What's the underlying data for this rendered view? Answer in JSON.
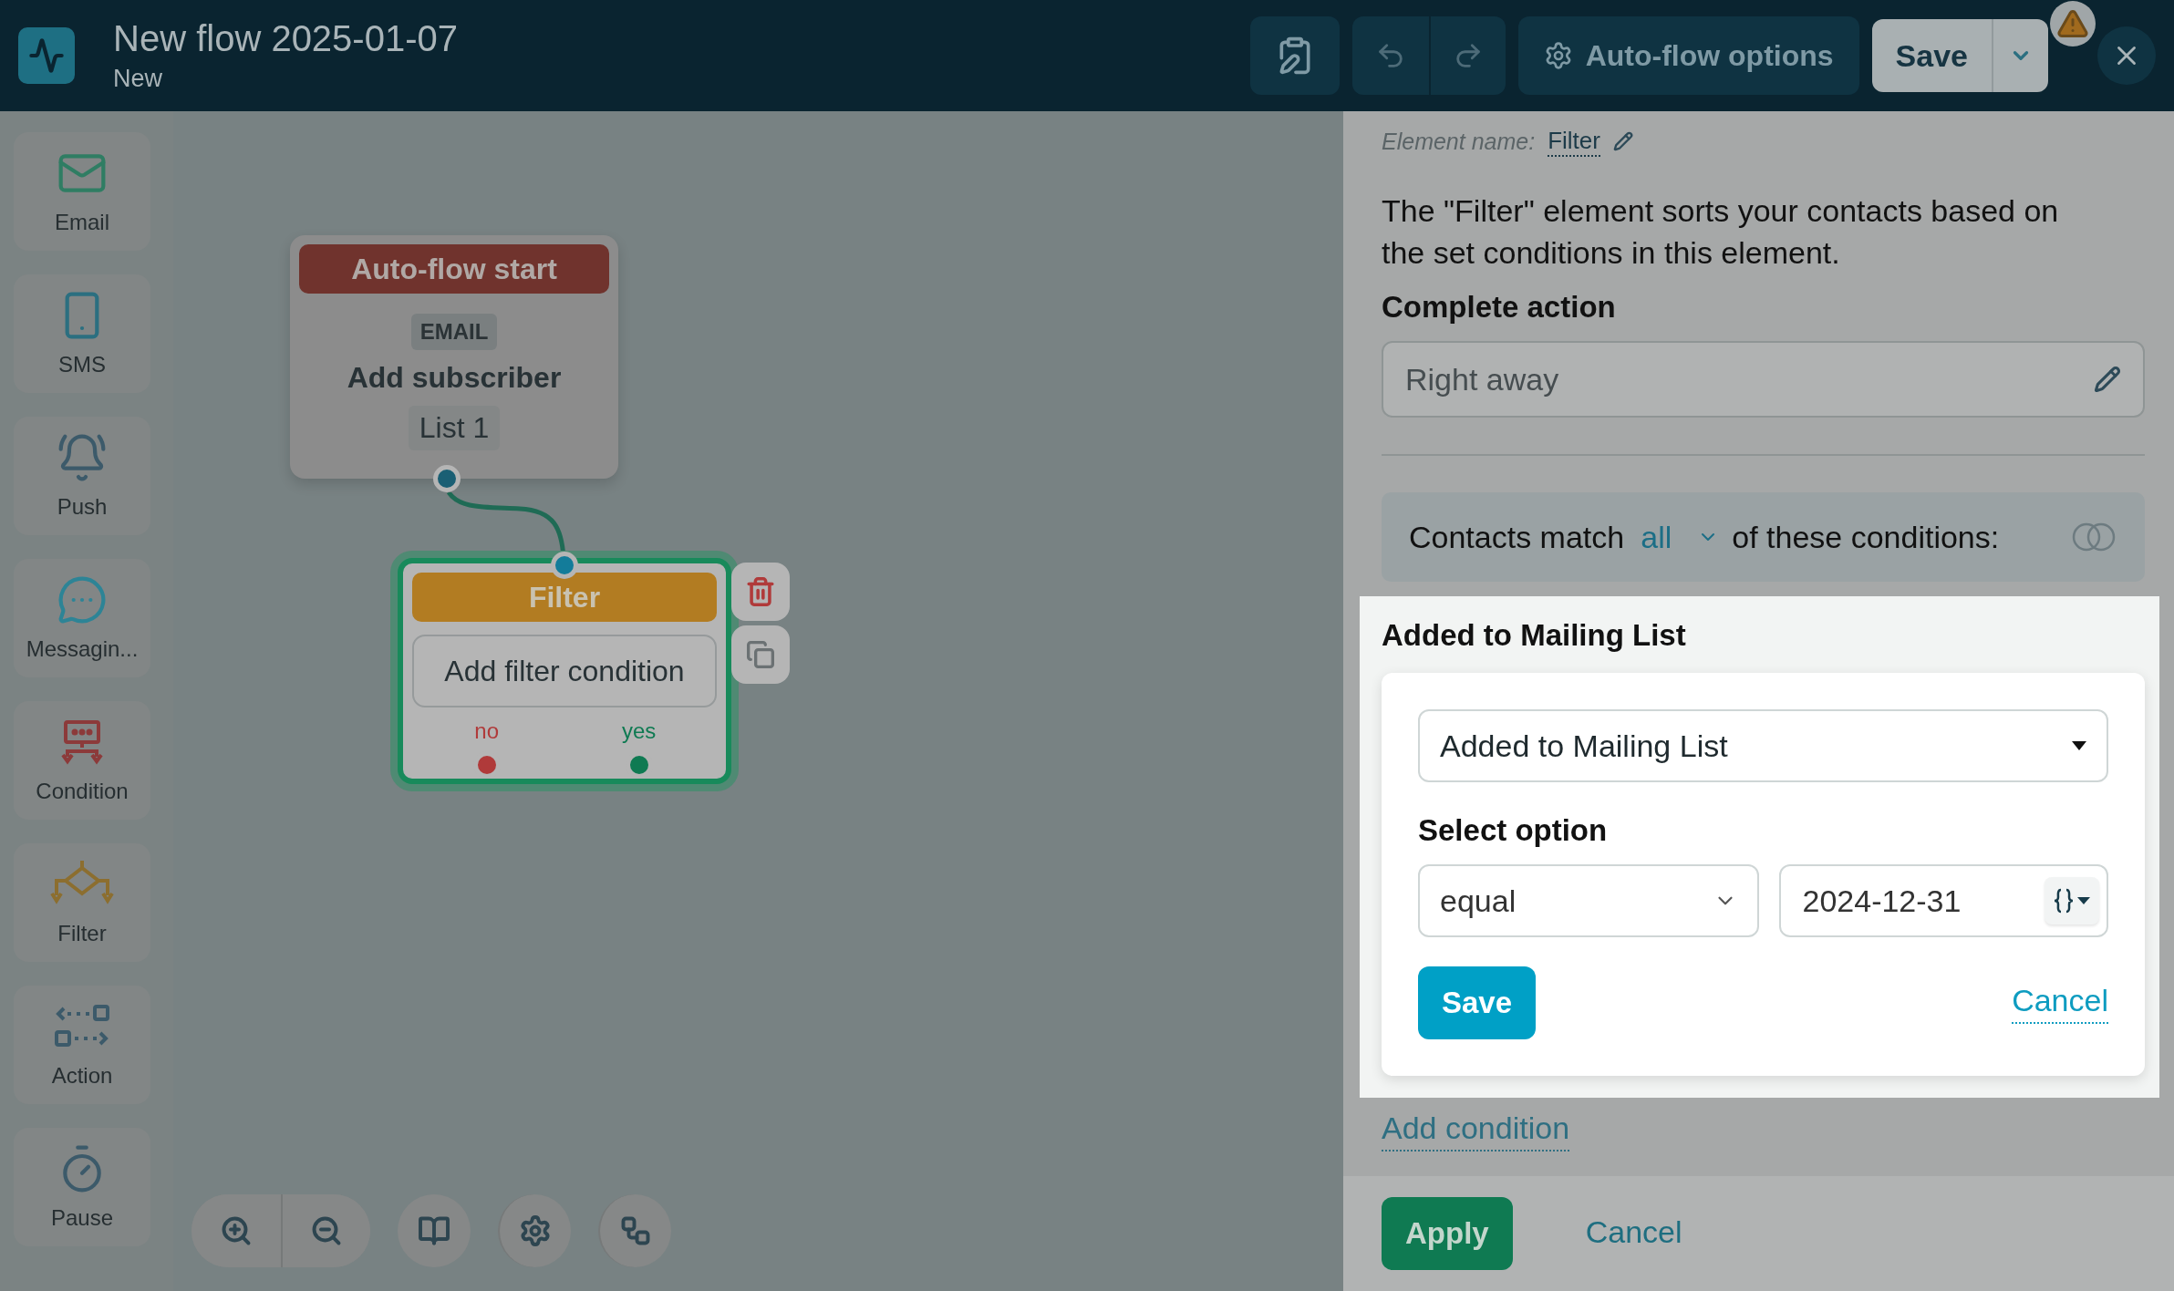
{
  "header": {
    "title": "New flow 2025-01-07",
    "subtitle": "New",
    "options_button": "Auto-flow options",
    "save_button": "Save"
  },
  "palette": [
    {
      "kind": "email",
      "label": "Email"
    },
    {
      "kind": "sms",
      "label": "SMS"
    },
    {
      "kind": "push",
      "label": "Push"
    },
    {
      "kind": "messaging",
      "label": "Messagin..."
    },
    {
      "kind": "condition",
      "label": "Condition"
    },
    {
      "kind": "filter",
      "label": "Filter"
    },
    {
      "kind": "action",
      "label": "Action"
    },
    {
      "kind": "pause",
      "label": "Pause"
    }
  ],
  "canvas": {
    "nodes": [
      {
        "kind": "start",
        "selected": false,
        "header": "Auto-flow start",
        "tag": "EMAIL",
        "title": "Add subscriber",
        "list": "List 1"
      },
      {
        "kind": "filter",
        "selected": true,
        "header": "Filter",
        "action": "Add filter condition",
        "outputs": [
          {
            "label": "no",
            "color": "#b03a3a"
          },
          {
            "label": "yes",
            "color": "#0f7a52"
          }
        ]
      }
    ]
  },
  "panel": {
    "element_name_label": "Element name:",
    "element_name": "Filter",
    "description": "The \"Filter\" element sorts your contacts based on the set conditions in this element.",
    "complete_action_label": "Complete action",
    "complete_action_value": "Right away",
    "match_prefix": "Contacts match",
    "match_option": "all",
    "match_suffix": "of these conditions:",
    "condition": {
      "title": "Added to Mailing List",
      "select_value": "Added to Mailing List",
      "option_label": "Select option",
      "operator": "equal",
      "date": "2024-12-31",
      "save": "Save",
      "cancel": "Cancel"
    },
    "add_condition": "Add condition",
    "apply": "Apply",
    "cancel": "Cancel"
  }
}
